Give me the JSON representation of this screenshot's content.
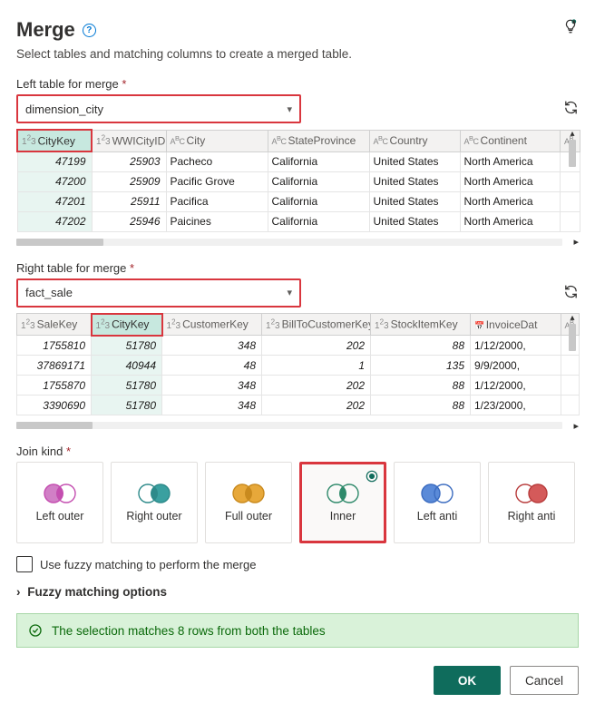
{
  "title": "Merge",
  "subtitle": "Select tables and matching columns to create a merged table.",
  "left": {
    "label": "Left table for merge",
    "dropdown_value": "dimension_city",
    "columns": [
      "CityKey",
      "WWICityID",
      "City",
      "StateProvince",
      "Country",
      "Continent"
    ],
    "column_types": [
      "num",
      "num",
      "text",
      "text",
      "text",
      "text"
    ],
    "selected_column_index": 0,
    "rows": [
      [
        "47199",
        "25903",
        "Pacheco",
        "California",
        "United States",
        "North America"
      ],
      [
        "47200",
        "25909",
        "Pacific Grove",
        "California",
        "United States",
        "North America"
      ],
      [
        "47201",
        "25911",
        "Pacifica",
        "California",
        "United States",
        "North America"
      ],
      [
        "47202",
        "25946",
        "Paicines",
        "California",
        "United States",
        "North America"
      ]
    ]
  },
  "right": {
    "label": "Right table for merge",
    "dropdown_value": "fact_sale",
    "columns": [
      "SaleKey",
      "CityKey",
      "CustomerKey",
      "BillToCustomerKey",
      "StockItemKey",
      "InvoiceDat"
    ],
    "column_types": [
      "num",
      "num",
      "num",
      "num",
      "num",
      "date"
    ],
    "selected_column_index": 1,
    "rows": [
      [
        "1755810",
        "51780",
        "348",
        "202",
        "88",
        "1/12/2000,"
      ],
      [
        "37869171",
        "40944",
        "48",
        "1",
        "135",
        "9/9/2000,"
      ],
      [
        "1755870",
        "51780",
        "348",
        "202",
        "88",
        "1/12/2000,"
      ],
      [
        "3390690",
        "51780",
        "348",
        "202",
        "88",
        "1/23/2000,"
      ]
    ]
  },
  "join": {
    "label": "Join kind",
    "options": [
      "Left outer",
      "Right outer",
      "Full outer",
      "Inner",
      "Left anti",
      "Right anti"
    ],
    "selected_index": 3
  },
  "fuzzy_checkbox": "Use fuzzy matching to perform the merge",
  "fuzzy_expand": "Fuzzy matching options",
  "status": "The selection matches 8 rows from both the tables",
  "buttons": {
    "ok": "OK",
    "cancel": "Cancel"
  }
}
